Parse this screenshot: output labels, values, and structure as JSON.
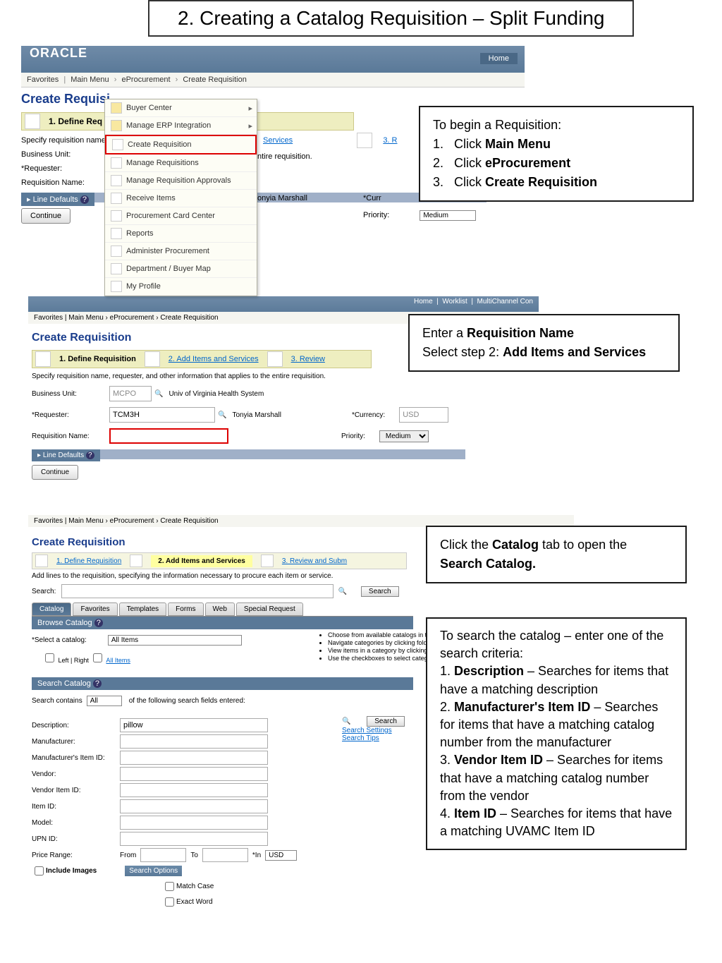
{
  "header": {
    "title": "2. Creating a Catalog Requisition – Split Funding"
  },
  "s1": {
    "logo": "ORACLE",
    "home": "Home",
    "crumbs": {
      "fav": "Favorites",
      "mm": "Main Menu",
      "ep": "eProcurement",
      "cr": "Create Requisition"
    },
    "pageTitle": "Create Requisi",
    "step1": "1. Define Req",
    "svcLink": "Services",
    "rLink": "3. R",
    "specify": "Specify requisition name,",
    "entireReq": "ntire requisition.",
    "bu": "Business Unit:",
    "req": "*Requester:",
    "reqName": "Requisition Name:",
    "onyia": "onyia Marshall",
    "cur": "*Curr",
    "prio": "Priority:",
    "med": "Medium",
    "lineDef": "Line Defaults",
    "cont": "Continue",
    "menu": {
      "bc": "Buyer Center",
      "mei": "Manage ERP Integration",
      "cr": "Create Requisition",
      "mr": "Manage Requisitions",
      "mra": "Manage Requisition Approvals",
      "ri": "Receive Items",
      "pcc": "Procurement Card Center",
      "rep": "Reports",
      "ap": "Administer Procurement",
      "dbm": "Department / Buyer Map",
      "mp": "My Profile"
    },
    "callout": {
      "intro": "To begin a Requisition:",
      "i1a": "Click ",
      "i1b": "Main Menu",
      "i2a": "Click ",
      "i2b": "eProcurement",
      "i3a": "Click ",
      "i3b": "Create Requisition"
    }
  },
  "s2": {
    "topbar": {
      "home": "Home",
      "worklist": "Worklist",
      "multi": "MultiChannel Con"
    },
    "crumbs": {
      "fav": "Favorites",
      "mm": "Main Menu",
      "ep": "eProcurement",
      "cr": "Create Requisition"
    },
    "pageTitle": "Create Requisition",
    "step1": "1. Define Requisition",
    "step2": "2. Add Items and Services",
    "step3": "3. Review",
    "specify": "Specify requisition name, requester, and other information that applies to the entire requisition.",
    "bu": "Business Unit:",
    "buVal": "MCPO",
    "buHint": "Univ of Virginia Health System",
    "req": "*Requester:",
    "reqVal": "TCM3H",
    "reqName2": "Tonyia Marshall",
    "reqName": "Requisition Name:",
    "cur": "*Currency:",
    "curVal": "USD",
    "prio": "Priority:",
    "med": "Medium",
    "lineDef": "Line Defaults",
    "cont": "Continue",
    "callout": {
      "l1a": "Enter a ",
      "l1b": "Requisition Name",
      "l2a": "Select step 2: ",
      "l2b": "Add Items and Services"
    }
  },
  "s3": {
    "crumbs": {
      "fav": "Favorites",
      "mm": "Main Menu",
      "ep": "eProcurement",
      "cr": "Create Requisition"
    },
    "pageTitle": "Create Requisition",
    "step1": "1. Define Requisition",
    "step2": "2. Add Items and Services",
    "step3": "3. Review and Subm",
    "addLines": "Add lines to the requisition, specifying the information necessary to procure each item or service.",
    "searchLbl": "Search:",
    "searchBtn": "Search",
    "tabs": {
      "catalog": "Catalog",
      "fav": "Favorites",
      "tpl": "Templates",
      "forms": "Forms",
      "web": "Web",
      "spec": "Special Request"
    },
    "browseCat": "Browse Catalog",
    "selCat": "*Select a catalog:",
    "allItems": "All Items",
    "leftRight": "Left | Right",
    "allItemsLink": "All Items",
    "hints": {
      "h1": "Choose from available catalogs in the dropdown list",
      "h2": "Navigate categories by clicking folde",
      "h3": "View items in a category by clicking t category name",
      "h4": "Use the checkboxes to select categories to search below"
    },
    "searchCat": "Search Catalog",
    "searchContains": "Search contains",
    "allOpt": "All",
    "ofFields": "of the following search fields entered:",
    "desc": "Description:",
    "descVal": "pillow",
    "manuf": "Manufacturer:",
    "manufItem": "Manufacturer's Item ID:",
    "vendor": "Vendor:",
    "vendorItem": "Vendor Item ID:",
    "itemId": "Item ID:",
    "model": "Model:",
    "upn": "UPN ID:",
    "priceRange": "Price Range:",
    "from": "From",
    "to": "To",
    "in": "*In",
    "usd": "USD",
    "includeImg": "Include Images",
    "searchOpt": "Search Options",
    "matchCase": "Match Case",
    "exactWord": "Exact Word",
    "searchSettings": "Search Settings",
    "searchTips": "Search Tips",
    "callout1": {
      "l1a": "Click the ",
      "l1b": "Catalog",
      "l1c": " tab to open the ",
      "l2": "Search Catalog."
    },
    "callout2": {
      "intro": "To search the catalog – enter one of the search criteria:",
      "i1a": "1. ",
      "i1b": "Description",
      "i1c": " – Searches for items that have a matching description",
      "i2a": "2. ",
      "i2b": "Manufacturer's Item ID",
      "i2c": " – Searches for items that have a matching catalog number from the manufacturer",
      "i3a": "3. ",
      "i3b": "Vendor Item ID",
      "i3c": " – Searches for items that have a matching catalog number from the vendor",
      "i4a": "4. ",
      "i4b": "Item ID",
      "i4c": " – Searches for items that have a matching UVAMC Item ID"
    }
  }
}
